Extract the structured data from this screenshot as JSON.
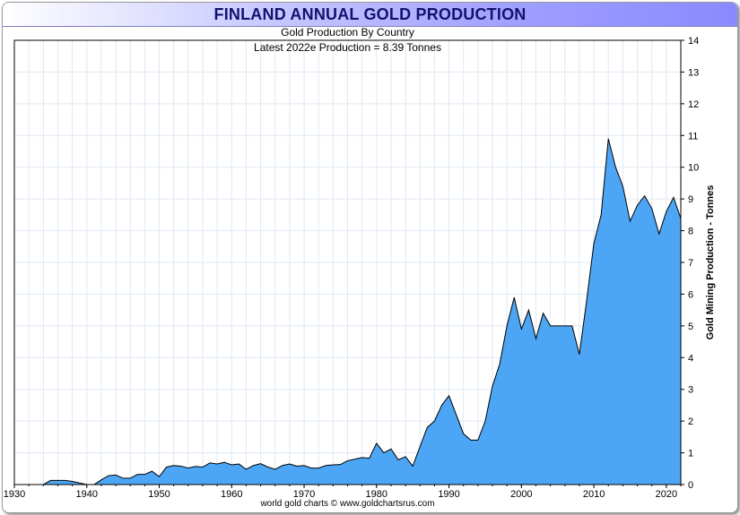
{
  "header": {
    "title": "FINLAND ANNUAL GOLD PRODUCTION"
  },
  "chart_data": {
    "type": "area",
    "title": "FINLAND ANNUAL GOLD PRODUCTION",
    "subtitle": "Gold Production By Country",
    "annotation": "Latest 2022e  Production = 8.39 Tonnes",
    "xlabel": "",
    "ylabel": "Gold Mining Production - Tonnes",
    "footer": "world gold charts © www.goldchartsrus.com",
    "xlim": [
      1930,
      2022
    ],
    "ylim": [
      0,
      14
    ],
    "y_axis_side": "right",
    "grid": true,
    "fill_color": "#4da6f5",
    "line_color": "#000000",
    "grid_color": "#dfe8f2",
    "x_ticks": [
      "1930",
      "1940",
      "1950",
      "1960",
      "1970",
      "1980",
      "1990",
      "2000",
      "2010",
      "2020"
    ],
    "y_ticks": [
      "0",
      "1",
      "2",
      "3",
      "4",
      "5",
      "6",
      "7",
      "8",
      "9",
      "10",
      "11",
      "12",
      "13",
      "14"
    ],
    "series": [
      {
        "x": [
          1930,
          1931,
          1932,
          1933,
          1934,
          1935,
          1936,
          1937,
          1938,
          1939,
          1940,
          1941,
          1942,
          1943,
          1944,
          1945,
          1946,
          1947,
          1948,
          1949,
          1950,
          1951,
          1952,
          1953,
          1954,
          1955,
          1956,
          1957,
          1958,
          1959,
          1960,
          1961,
          1962,
          1963,
          1964,
          1965,
          1966,
          1967,
          1968,
          1969,
          1970,
          1971,
          1972,
          1973,
          1974,
          1975,
          1976,
          1977,
          1978,
          1979,
          1980,
          1981,
          1982,
          1983,
          1984,
          1985,
          1986,
          1987,
          1988,
          1989,
          1990,
          1991,
          1992,
          1993,
          1994,
          1995,
          1996,
          1997,
          1998,
          1999,
          2000,
          2001,
          2002,
          2003,
          2004,
          2005,
          2006,
          2007,
          2008,
          2009,
          2010,
          2011,
          2012,
          2013,
          2014,
          2015,
          2016,
          2017,
          2018,
          2019,
          2020,
          2021,
          2022
        ],
        "values": [
          0,
          0,
          0,
          0,
          0,
          0.13,
          0.13,
          0.13,
          0.1,
          0.05,
          0,
          0,
          0.15,
          0.28,
          0.3,
          0.2,
          0.2,
          0.32,
          0.32,
          0.42,
          0.25,
          0.55,
          0.6,
          0.58,
          0.52,
          0.57,
          0.55,
          0.68,
          0.65,
          0.7,
          0.62,
          0.65,
          0.48,
          0.6,
          0.66,
          0.55,
          0.48,
          0.6,
          0.65,
          0.58,
          0.6,
          0.52,
          0.52,
          0.6,
          0.62,
          0.63,
          0.75,
          0.8,
          0.85,
          0.83,
          1.3,
          1.0,
          1.12,
          0.78,
          0.88,
          0.58,
          1.2,
          1.8,
          2.0,
          2.5,
          2.8,
          2.2,
          1.6,
          1.4,
          1.4,
          2.0,
          3.1,
          3.8,
          5.0,
          5.9,
          4.9,
          5.5,
          4.6,
          5.4,
          5.0,
          5.0,
          5.0,
          5.0,
          4.1,
          5.8,
          7.6,
          8.5,
          10.9,
          10.0,
          9.4,
          8.3,
          8.8,
          9.1,
          8.7,
          7.9,
          8.6,
          9.05,
          8.39
        ]
      }
    ]
  }
}
